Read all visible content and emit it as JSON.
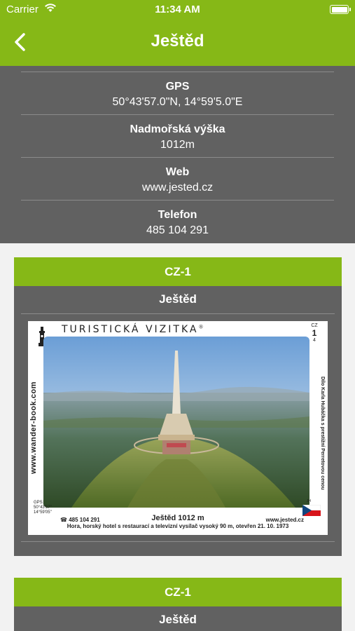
{
  "status_bar": {
    "carrier": "Carrier",
    "time": "11:34 AM"
  },
  "nav": {
    "title": "Ještěd",
    "back_icon": "chevron-left-icon"
  },
  "info": [
    {
      "label": "GPS",
      "value": "50°43'57.0\"N, 14°59'5.0\"E"
    },
    {
      "label": "Nadmořská výška",
      "value": "1012m"
    },
    {
      "label": "Web",
      "value": "www.jested.cz"
    },
    {
      "label": "Telefon",
      "value": "485 104 291"
    }
  ],
  "cards": [
    {
      "code": "CZ-1",
      "name": "Ještěd",
      "image": {
        "brand": "TURISTICKÁ VIZITKA",
        "brand_mark": "®",
        "side_left": "www.wander-book.com",
        "side_right": "Dílo Karla Hubáčka s prestižní Perretovou cenou",
        "box_country": "CZ",
        "box_number": "1",
        "box_sub": "4",
        "gps_label": "GPS:",
        "gps_lat": "50°43'57\"",
        "gps_lon": "14°59'05\"",
        "phone": "☎ 485 104 291",
        "name": "Ještěd 1012 m",
        "web": "www.jested.cz",
        "description": "Hora, horský hotel s restaurací a televizní vysílač vysoký 90 m, otevřen 21. 10. 1973",
        "flag_code": "JH"
      }
    },
    {
      "code": "CZ-1",
      "name": "Ještěd"
    }
  ],
  "colors": {
    "accent": "#86b817",
    "panel": "#616161",
    "background": "#f2f2f2"
  }
}
